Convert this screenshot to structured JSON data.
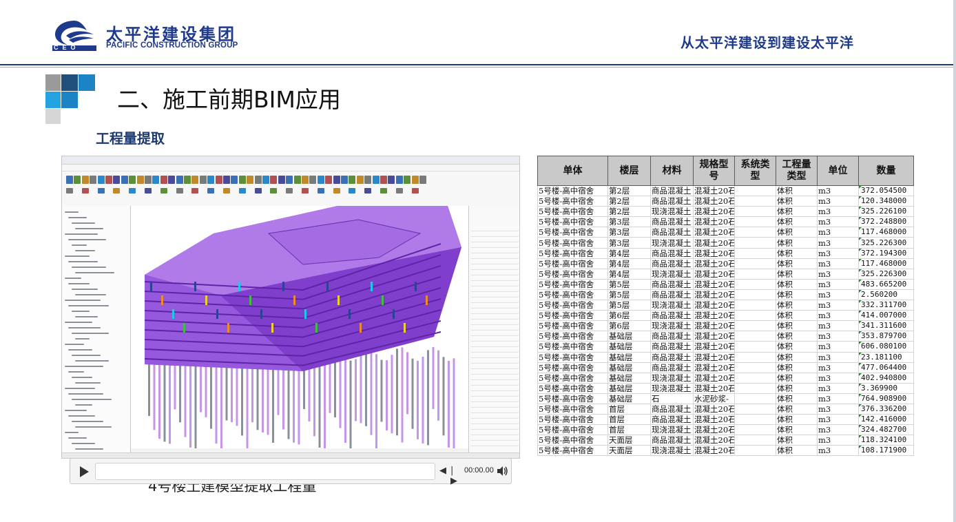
{
  "header": {
    "company_cn": "太平洋建设集团",
    "company_en": "PACIFIC CONSTRUCTION GROUP",
    "logo_text": "CEO",
    "slogan": "从太平洋建设到建设太平洋"
  },
  "section": {
    "title": "二、施工前期BIM应用",
    "subtitle": "工程量提取"
  },
  "video": {
    "caption": "4号楼土建模型提取工程量",
    "time": "00:00.00"
  },
  "colors": {
    "brand": "#1f3a8a",
    "model_purple": "#9b5de5",
    "header_gray": "#c9c9c9"
  },
  "table": {
    "headers": [
      "单体",
      "楼层",
      "材料",
      "规格型号",
      "系统类型",
      "工程量类型",
      "单位",
      "数量"
    ],
    "rows": [
      [
        "5号楼-高中宿舍",
        "第2层",
        "商品混凝土",
        "混凝土20石",
        "",
        "体积",
        "m3",
        "372.054500"
      ],
      [
        "5号楼-高中宿舍",
        "第2层",
        "商品混凝土",
        "混凝土20石",
        "",
        "体积",
        "m3",
        "120.348000"
      ],
      [
        "5号楼-高中宿舍",
        "第2层",
        "现浇混凝土",
        "混凝土20石",
        "",
        "体积",
        "m3",
        "325.226100"
      ],
      [
        "5号楼-高中宿舍",
        "第3层",
        "商品混凝土",
        "混凝土20石",
        "",
        "体积",
        "m3",
        "372.248800"
      ],
      [
        "5号楼-高中宿舍",
        "第3层",
        "商品混凝土",
        "混凝土20石",
        "",
        "体积",
        "m3",
        "117.468000"
      ],
      [
        "5号楼-高中宿舍",
        "第3层",
        "现浇混凝土",
        "混凝土20石",
        "",
        "体积",
        "m3",
        "325.226300"
      ],
      [
        "5号楼-高中宿舍",
        "第4层",
        "商品混凝土",
        "混凝土20石",
        "",
        "体积",
        "m3",
        "372.194300"
      ],
      [
        "5号楼-高中宿舍",
        "第4层",
        "商品混凝土",
        "混凝土20石",
        "",
        "体积",
        "m3",
        "117.468000"
      ],
      [
        "5号楼-高中宿舍",
        "第4层",
        "现浇混凝土",
        "混凝土20石",
        "",
        "体积",
        "m3",
        "325.226300"
      ],
      [
        "5号楼-高中宿舍",
        "第5层",
        "商品混凝土",
        "混凝土20石",
        "",
        "体积",
        "m3",
        "483.665200"
      ],
      [
        "5号楼-高中宿舍",
        "第5层",
        "商品混凝土",
        "混凝土20石",
        "",
        "体积",
        "m3",
        "2.560200"
      ],
      [
        "5号楼-高中宿舍",
        "第5层",
        "现浇混凝土",
        "混凝土20石",
        "",
        "体积",
        "m3",
        "332.311700"
      ],
      [
        "5号楼-高中宿舍",
        "第6层",
        "商品混凝土",
        "混凝土20石",
        "",
        "体积",
        "m3",
        "414.007000"
      ],
      [
        "5号楼-高中宿舍",
        "第6层",
        "现浇混凝土",
        "混凝土20石",
        "",
        "体积",
        "m3",
        "341.311600"
      ],
      [
        "5号楼-高中宿舍",
        "基础层",
        "商品混凝土",
        "混凝土20石",
        "",
        "体积",
        "m3",
        "353.879700"
      ],
      [
        "5号楼-高中宿舍",
        "基础层",
        "商品混凝土",
        "混凝土20石",
        "",
        "体积",
        "m3",
        "606.080100"
      ],
      [
        "5号楼-高中宿舍",
        "基础层",
        "商品混凝土",
        "混凝土20石",
        "",
        "体积",
        "m3",
        "23.181100"
      ],
      [
        "5号楼-高中宿舍",
        "基础层",
        "商品混凝土",
        "混凝土20石",
        "",
        "体积",
        "m3",
        "477.064400"
      ],
      [
        "5号楼-高中宿舍",
        "基础层",
        "现浇混凝土",
        "混凝土20石",
        "",
        "体积",
        "m3",
        "402.940800"
      ],
      [
        "5号楼-高中宿舍",
        "基础层",
        "现浇混凝土",
        "混凝土20石",
        "",
        "体积",
        "m3",
        "3.369900"
      ],
      [
        "5号楼-高中宿舍",
        "基础层",
        "石",
        "水泥砂浆-",
        "",
        "体积",
        "m3",
        "764.908900"
      ],
      [
        "5号楼-高中宿舍",
        "首层",
        "商品混凝土",
        "混凝土20石",
        "",
        "体积",
        "m3",
        "376.336200"
      ],
      [
        "5号楼-高中宿舍",
        "首层",
        "商品混凝土",
        "混凝土20石",
        "",
        "体积",
        "m3",
        "142.416000"
      ],
      [
        "5号楼-高中宿舍",
        "首层",
        "现浇混凝土",
        "混凝土20石",
        "",
        "体积",
        "m3",
        "324.482700"
      ],
      [
        "5号楼-高中宿舍",
        "天面层",
        "商品混凝土",
        "混凝土20石",
        "",
        "体积",
        "m3",
        "118.324100"
      ],
      [
        "5号楼-高中宿舍",
        "天面层",
        "现浇混凝土",
        "混凝土20石",
        "",
        "体积",
        "m3",
        "108.171900"
      ]
    ]
  }
}
